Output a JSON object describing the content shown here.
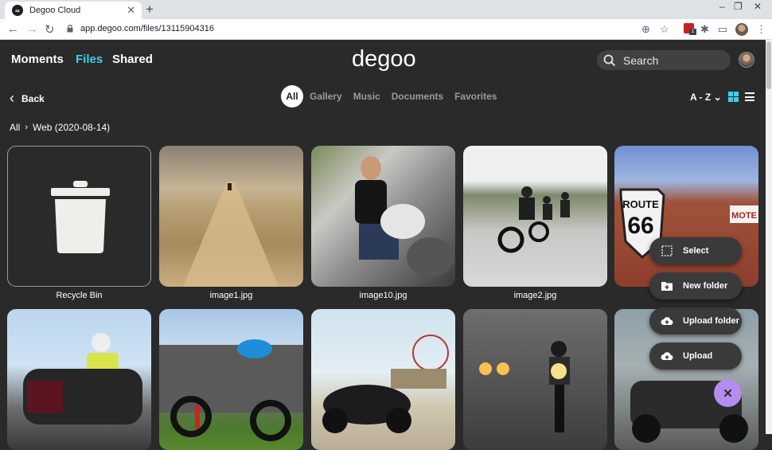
{
  "browser": {
    "tab_title": "Degoo Cloud",
    "tab_favicon": "degoo-favicon",
    "url": "app.degoo.com/files/13115904316",
    "window_controls": [
      "–",
      "❐",
      "✕"
    ],
    "extension_badge": "1"
  },
  "header": {
    "nav": [
      "Moments",
      "Files",
      "Shared"
    ],
    "active_nav": "Files",
    "logo": "degoo",
    "search_label": "Search"
  },
  "toolbar": {
    "back_label": "Back",
    "filters": [
      "All",
      "Gallery",
      "Music",
      "Documents",
      "Favorites"
    ],
    "active_filter": "All",
    "sort_label": "A - Z"
  },
  "breadcrumb": {
    "root": "All",
    "current": "Web (2020-08-14)"
  },
  "files": [
    {
      "label": "Recycle Bin",
      "kind": "folder"
    },
    {
      "label": "image1.jpg",
      "kind": "image"
    },
    {
      "label": "image10.jpg",
      "kind": "image"
    },
    {
      "label": "image2.jpg",
      "kind": "image"
    },
    {
      "label": "",
      "kind": "image"
    },
    {
      "label": "",
      "kind": "image"
    },
    {
      "label": "",
      "kind": "image"
    },
    {
      "label": "",
      "kind": "image"
    },
    {
      "label": "",
      "kind": "image"
    },
    {
      "label": "",
      "kind": "image"
    }
  ],
  "fab_menu": {
    "items": [
      {
        "label": "Select",
        "icon": "select-icon"
      },
      {
        "label": "New folder",
        "icon": "new-folder-icon"
      },
      {
        "label": "Upload folder",
        "icon": "upload-folder-icon"
      },
      {
        "label": "Upload",
        "icon": "upload-icon"
      }
    ],
    "close_icon": "close-icon"
  },
  "colors": {
    "background": "#2a2a2a",
    "accent": "#3ecfe8",
    "fab": "#b58cf0"
  }
}
